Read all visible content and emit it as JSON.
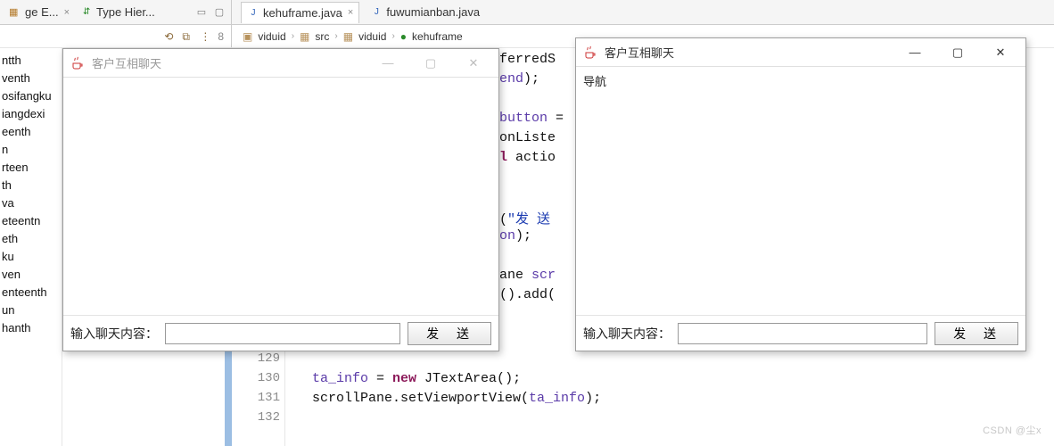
{
  "tabs_left": [
    {
      "label": "ge E...",
      "icon": "package-icon",
      "close": "×"
    },
    {
      "label": "Type Hier...",
      "icon": "type-icon",
      "close": ""
    }
  ],
  "pane_controls_left": [
    "min",
    "max"
  ],
  "tabs_right": [
    {
      "label": "kehuframe.java",
      "icon": "java-icon",
      "close": "×",
      "active": true
    },
    {
      "label": "fuwumianban.java",
      "icon": "java-icon",
      "close": "",
      "active": false
    }
  ],
  "toolbar_left_icons": [
    "link",
    "back",
    "menu",
    "num"
  ],
  "toolbar_left_num": "8",
  "breadcrumb": [
    {
      "icon": "proj",
      "label": "viduid"
    },
    {
      "icon": "src",
      "label": "src"
    },
    {
      "icon": "pkg",
      "label": "viduid"
    },
    {
      "icon": "class",
      "label": "kehuframe"
    }
  ],
  "sidebar_items": [
    "ntth",
    "venth",
    "osifangku",
    "iangdexi",
    "eenth",
    "n",
    "rteen",
    "th",
    "va",
    "eteentn",
    "eth",
    "ku",
    "ven",
    "enteenth",
    "un",
    "",
    "hanth"
  ],
  "code_lines_top": [
    {
      "text_parts": [
        [
          "plain",
          "ferredS"
        ]
      ]
    },
    {
      "text_parts": [
        [
          "id",
          "end"
        ],
        [
          "plain",
          ");"
        ]
      ]
    },
    {
      "text_parts": []
    },
    {
      "text_parts": [
        [
          "id",
          "button"
        ],
        [
          "plain",
          " ="
        ]
      ]
    },
    {
      "text_parts": [
        [
          "plain",
          "onListe"
        ]
      ]
    },
    {
      "text_parts": [
        [
          "kw",
          "l"
        ],
        [
          "plain",
          " actio"
        ]
      ]
    },
    {
      "text_parts": []
    },
    {
      "text_parts": []
    },
    {
      "text_parts": [
        [
          "plain",
          "("
        ],
        [
          "str",
          "\"发   送"
        ]
      ]
    },
    {
      "text_parts": [
        [
          "id",
          "on"
        ],
        [
          "plain",
          ");"
        ]
      ]
    },
    {
      "text_parts": []
    },
    {
      "text_parts": [
        [
          "plain",
          "ane "
        ],
        [
          "id",
          "scr"
        ]
      ]
    },
    {
      "text_parts": [
        [
          "plain",
          "().add("
        ]
      ]
    }
  ],
  "code_lines_bottom": [
    {
      "num": "129",
      "parts": []
    },
    {
      "num": "130",
      "parts": [
        [
          "plain",
          "            "
        ],
        [
          "id",
          "ta_info"
        ],
        [
          "plain",
          " = "
        ],
        [
          "kw",
          "new"
        ],
        [
          "plain",
          " JTextArea();"
        ]
      ]
    },
    {
      "num": "131",
      "parts": [
        [
          "plain",
          "            scrollPane.setViewportView("
        ],
        [
          "id",
          "ta_info"
        ],
        [
          "plain",
          ");"
        ]
      ]
    },
    {
      "num": "132",
      "parts": []
    }
  ],
  "popup_left": {
    "title": "客户互相聊天",
    "body": "",
    "input_label": "输入聊天内容：",
    "send_label": "发 送",
    "active": false
  },
  "popup_right": {
    "title": "客户互相聊天",
    "body": "导航",
    "input_label": "输入聊天内容：",
    "send_label": "发 送",
    "active": true
  },
  "watermark": "CSDN @尘x"
}
